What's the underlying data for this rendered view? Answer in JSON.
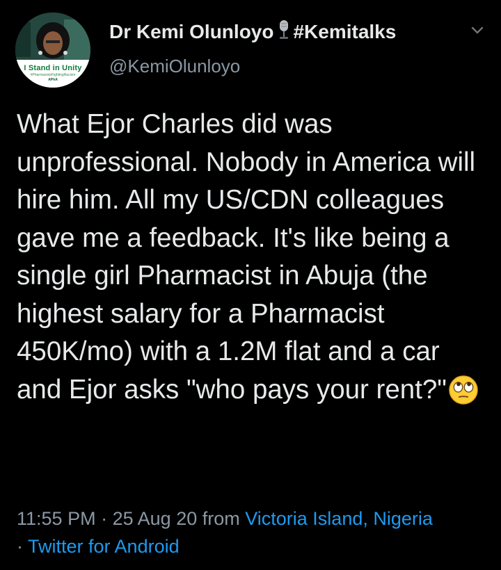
{
  "user": {
    "display_name": "Dr Kemi Olunloyo",
    "hashtag": "#Kemitalks",
    "handle": "@KemiOlunloyo",
    "avatar": {
      "badge_text": "I Stand in Unity",
      "badge_subtext": "#PharmacistsFightingRacism",
      "badge_logo": "APhA"
    }
  },
  "tweet": {
    "text": "What Ejor Charles did was unprofessional. Nobody in America will hire him. All my US/CDN colleagues gave me a feedback. It's like being a single girl Pharmacist in Abuja (the highest salary for a Pharmacist 450K/mo) with a 1.2M flat and a car and Ejor asks \"who pays your rent?\"",
    "emoji": "face-with-rolling-eyes"
  },
  "meta": {
    "time": "11:55 PM",
    "separator": "·",
    "date": "25 Aug 20",
    "from_label": "from",
    "location": "Victoria Island, Nigeria",
    "client": "Twitter for Android"
  },
  "icons": {
    "microphone": "studio-microphone-icon",
    "caret": "chevron-down-icon"
  },
  "colors": {
    "background": "#000000",
    "text": "#e7e9ea",
    "secondary": "#8b98a5",
    "link": "#1d9bf0"
  }
}
